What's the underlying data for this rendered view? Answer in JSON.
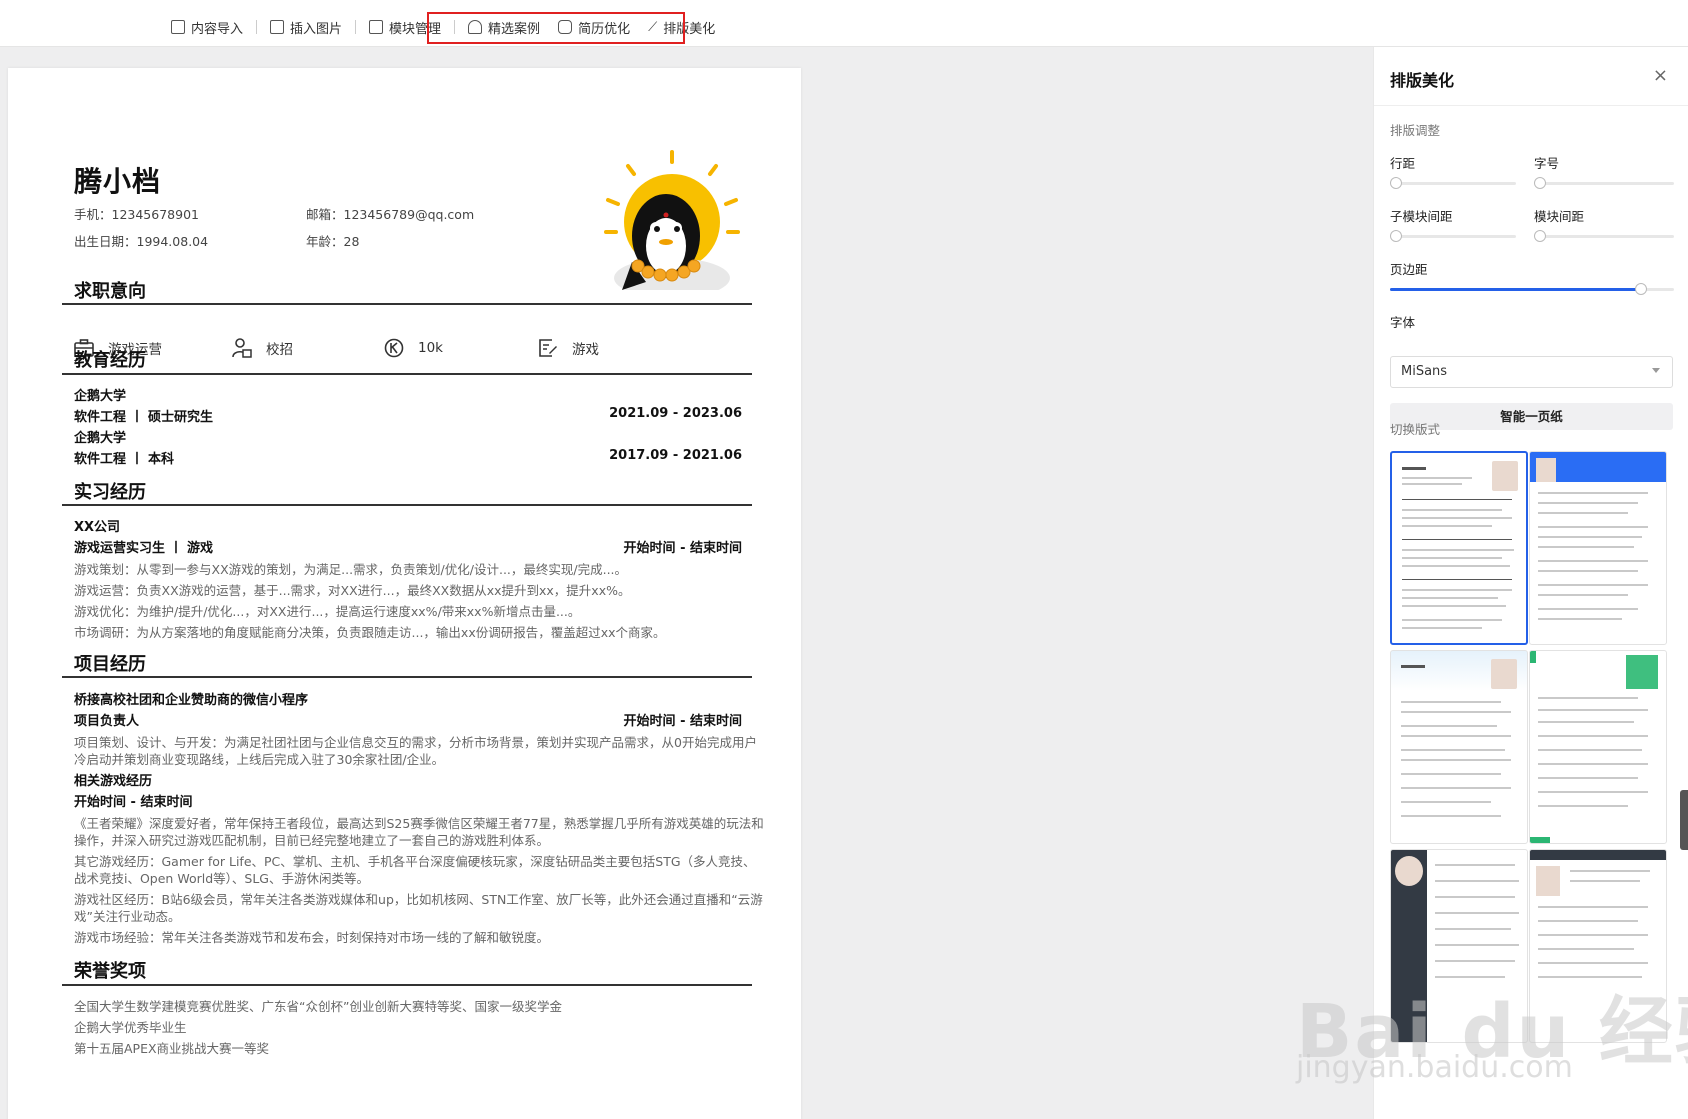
{
  "toolbar": {
    "items": [
      {
        "label": "内容导入"
      },
      {
        "label": "插入图片"
      },
      {
        "label": "模块管理"
      },
      {
        "label": "精选案例"
      },
      {
        "label": "简历优化"
      },
      {
        "label": "排版美化"
      }
    ],
    "highlight_color": "#e02020"
  },
  "resume": {
    "name": "腾小档",
    "phone": "手机：12345678901",
    "email": "邮箱：123456789@qq.com",
    "birth": "出生日期：1994.08.04",
    "age": "年龄：28",
    "sections": {
      "intent": "求职意向",
      "education": "教育经历",
      "internship": "实习经历",
      "project": "项目经历",
      "honors": "荣誉奖项"
    },
    "intent_items": [
      {
        "label": "游戏运营",
        "icon": "briefcase-icon"
      },
      {
        "label": "校招",
        "icon": "user-card-icon"
      },
      {
        "label": "10k",
        "icon": "salary-icon"
      },
      {
        "label": "游戏",
        "icon": "edit-doc-icon"
      }
    ],
    "education": [
      {
        "school": "企鹅大学",
        "major": "软件工程 丨 硕士研究生",
        "period": "2021.09 - 2023.06"
      },
      {
        "school": "企鹅大学",
        "major": "软件工程 丨 本科",
        "period": "2017.09 - 2021.06"
      }
    ],
    "internship": {
      "company": "XX公司",
      "role": "游戏运营实习生 丨 游戏",
      "period": "开始时间 - 结束时间",
      "lines": [
        "游戏策划：从零到一参与XX游戏的策划，为满足...需求，负责策划/优化/设计...，最终实现/完成...。",
        "游戏运营：负责XX游戏的运营，基于...需求，对XX进行...，最终XX数据从xx提升到xx，提升xx%。",
        "游戏优化：为维护/提升/优化...，对XX进行...，提高运行速度xx%/带来xx%新增点击量...。",
        "市场调研：为从方案落地的角度赋能商分决策，负责跟随走访...，输出xx份调研报告，覆盖超过xx个商家。"
      ]
    },
    "project": {
      "title": "桥接高校社团和企业赞助商的微信小程序",
      "role": "项目负责人",
      "period": "开始时间 - 结束时间",
      "desc_line1": "项目策划、设计、与开发：为满足社团社团与企业信息交互的需求，分析市场背景，策划并实现产品需求，从0开始完成用户",
      "desc_line2": "冷启动并策划商业变现路线，上线后完成入驻了30余家社团/企业。",
      "sub_title": "相关游戏经历",
      "sub_period": "开始时间 - 结束时间",
      "exp": [
        [
          "《王者荣耀》深度爱好者，常年保持王者段位，最高达到S25赛季微信区荣耀王者77星，熟悉掌握几乎所有游戏英雄的玩法和",
          "操作，并深入研究过游戏匹配机制，目前已经完整地建立了一套自己的游戏胜利体系。"
        ],
        [
          "其它游戏经历：Gamer for Life、PC、掌机、主机、手机各平台深度偏硬核玩家，深度钻研品类主要包括STG（多人竞技、",
          "战术竞技i、Open World等）、SLG、手游休闲类等。"
        ],
        [
          "游戏社区经历：B站6级会员，常年关注各类游戏媒体和up，比如机核网、STN工作室、放厂长等，此外还会通过直播和“云游",
          "戏”关注行业动态。"
        ],
        [
          "游戏市场经验：常年关注各类游戏节和发布会，时刻保持对市场一线的了解和敏锐度。"
        ]
      ]
    },
    "honors": [
      "全国大学生数学建模竞赛优胜奖、广东省“众创杯”创业创新大赛特等奖、国家一级奖学金",
      "企鹅大学优秀毕业生",
      "第十五届APEX商业挑战大赛一等奖"
    ]
  },
  "panel": {
    "title": "排版美化",
    "close": "×",
    "layout_section": "排版调整",
    "line_spacing": "行距",
    "font_size": "字号",
    "sub_module_spacing": "子模块间距",
    "module_spacing": "模块间距",
    "page_margin": "页边距",
    "page_margin_level": 0.9,
    "font_label": "字体",
    "font_value": "MiSans",
    "one_page_button": "智能一页纸",
    "switch_layout": "切换版式",
    "accent_color": "#2460e8"
  },
  "watermark": {
    "main": "Bai du 经验",
    "sub": "jingyan.baidu.com"
  }
}
